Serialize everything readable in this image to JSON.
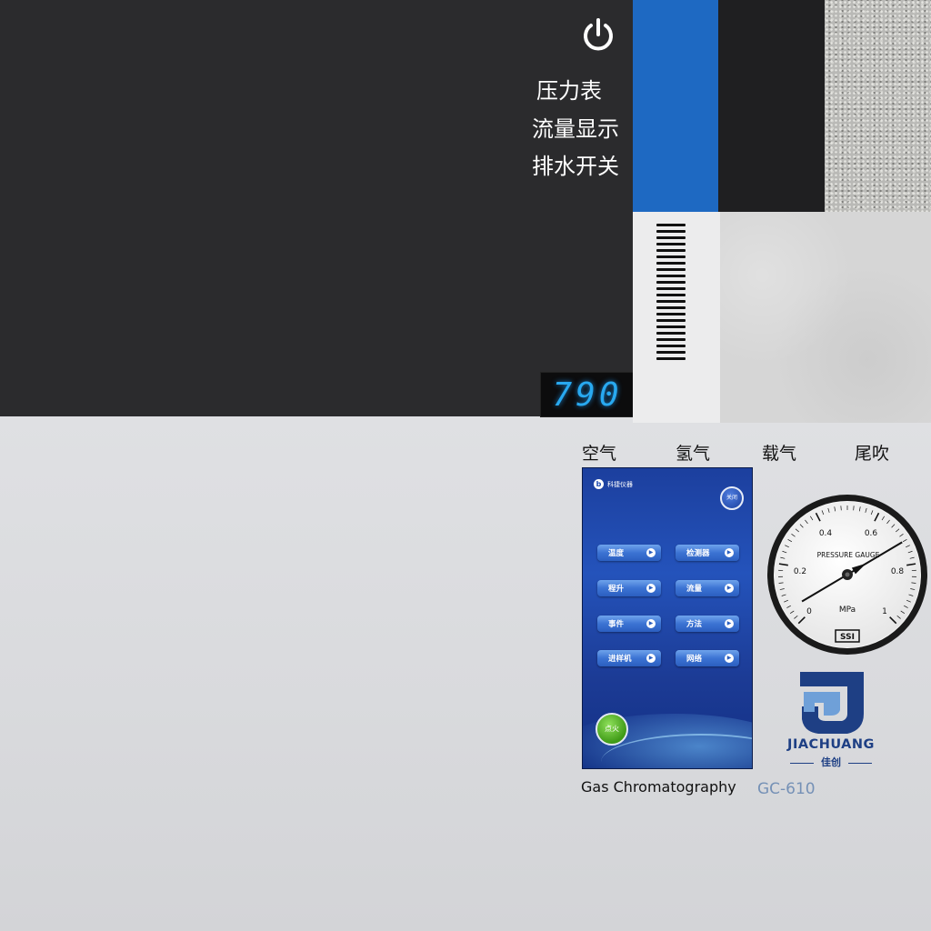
{
  "top_panel": {
    "power_icon": "power-icon",
    "menu": {
      "pressure_gauge": "压力表",
      "flow_display": "流量显示",
      "drain_switch": "排水开关"
    },
    "led_display_value": "790"
  },
  "swatches": {
    "colors": [
      "#1e69c2",
      "#1f1f21",
      "#b9b9b6",
      "#ececed",
      "#d6d6d6"
    ]
  },
  "gas_labels": {
    "air": "空气",
    "hydrogen": "氢气",
    "carrier": "载气",
    "makeup": "尾吹"
  },
  "screen": {
    "brand": "科捷仪器",
    "close_label": "关闭",
    "buttons": {
      "temperature": "温度",
      "detector": "检测器",
      "ramp": "程升",
      "flow": "流量",
      "events": "事件",
      "method": "方法",
      "injector": "进样机",
      "network": "网络"
    },
    "ignite_label": "点火"
  },
  "gauge": {
    "title": "PRESSURE GAUGE",
    "unit": "MPa",
    "ticks": [
      "0",
      "0.2",
      "0.4",
      "0.6",
      "0.8",
      "1"
    ],
    "maker": "SSI",
    "reading_fraction": 0.72
  },
  "footer": {
    "product_name": "Gas Chromatography",
    "model": "GC-610"
  },
  "logo": {
    "name": "JIACHUANG",
    "chinese": "佳创"
  }
}
